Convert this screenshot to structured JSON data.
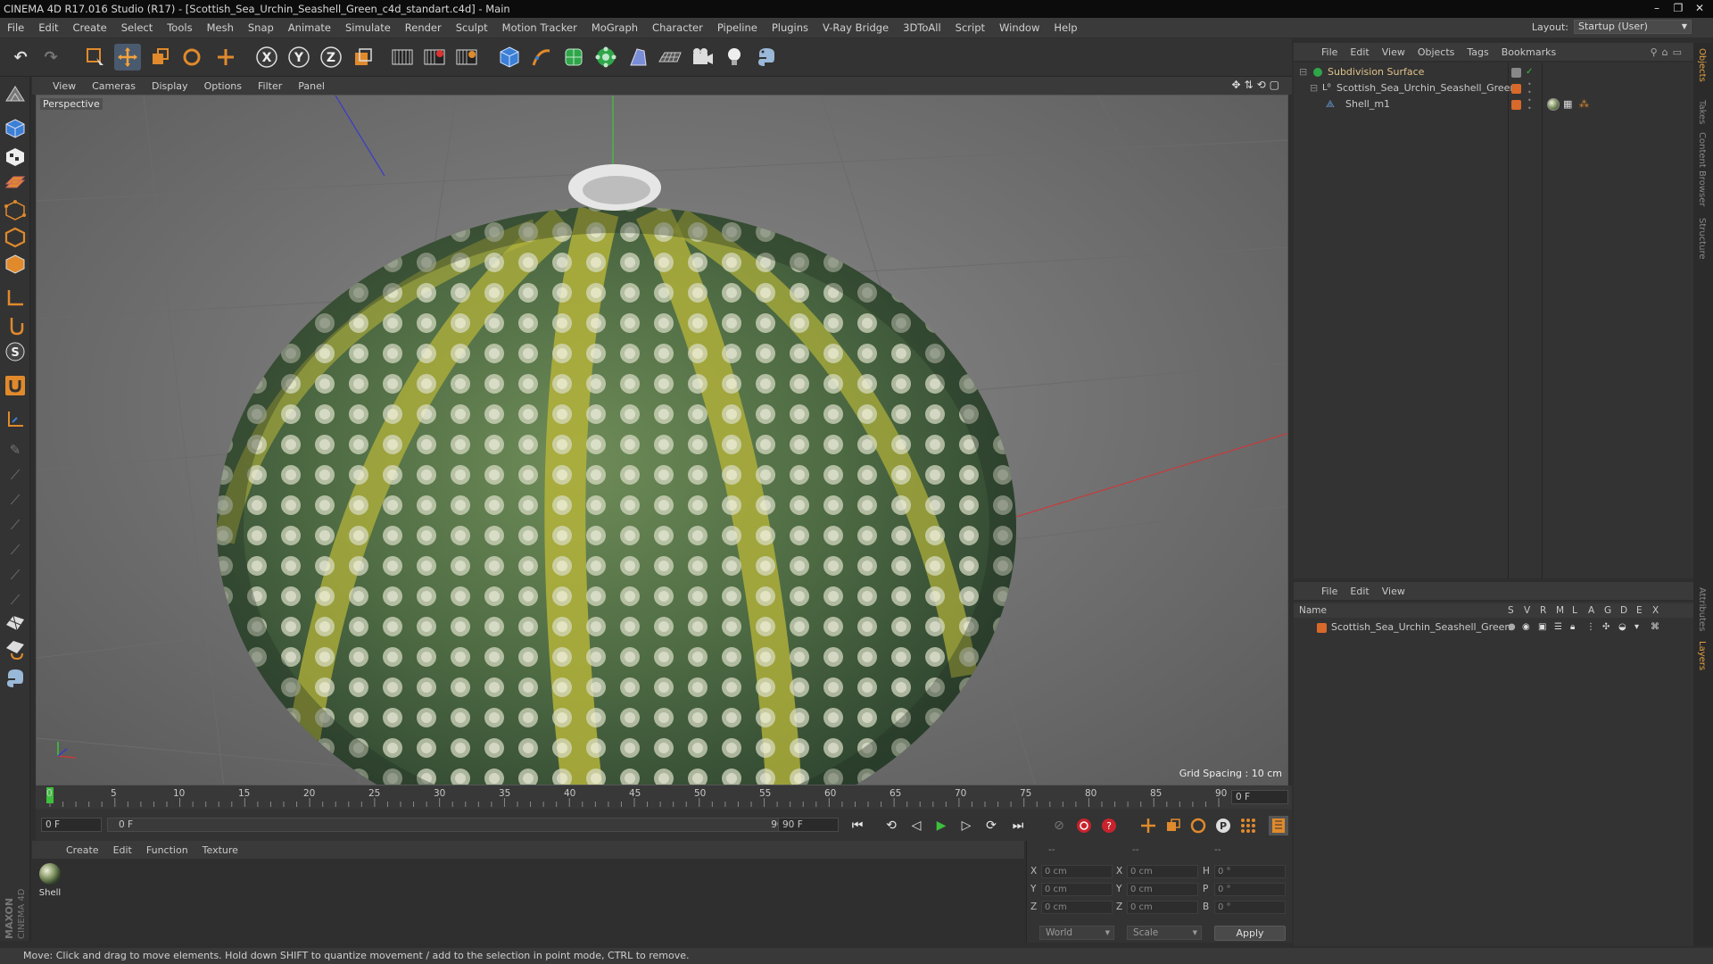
{
  "window": {
    "title": "CINEMA 4D R17.016 Studio (R17) - [Scottish_Sea_Urchin_Seashell_Green_c4d_standart.c4d] - Main"
  },
  "menubar": [
    "File",
    "Edit",
    "Create",
    "Select",
    "Tools",
    "Mesh",
    "Snap",
    "Animate",
    "Simulate",
    "Render",
    "Sculpt",
    "Motion Tracker",
    "MoGraph",
    "Character",
    "Pipeline",
    "Plugins",
    "V-Ray Bridge",
    "3DToAll",
    "Script",
    "Window",
    "Help"
  ],
  "layout": {
    "label": "Layout:",
    "value": "Startup (User)"
  },
  "viewport": {
    "menus": [
      "View",
      "Cameras",
      "Display",
      "Options",
      "Filter",
      "Panel"
    ],
    "label": "Perspective",
    "grid_spacing": "Grid Spacing : 10 cm"
  },
  "timeline": {
    "ticks": [
      "0",
      "5",
      "10",
      "15",
      "20",
      "25",
      "30",
      "35",
      "40",
      "45",
      "50",
      "55",
      "60",
      "65",
      "70",
      "75",
      "80",
      "85",
      "90"
    ],
    "current_frame_right": "0 F",
    "start_field": "0 F",
    "range_start": "0 F",
    "range_end": "90 F",
    "end_field": "90 F"
  },
  "material_manager": {
    "menus": [
      "Create",
      "Edit",
      "Function",
      "Texture"
    ],
    "materials": [
      {
        "name": "Shell"
      }
    ]
  },
  "coordinates": {
    "headers": [
      "--",
      "--",
      "--"
    ],
    "rows": [
      {
        "a": "X",
        "v1": "0 cm",
        "b": "X",
        "v2": "0 cm",
        "c": "H",
        "v3": "0 °"
      },
      {
        "a": "Y",
        "v1": "0 cm",
        "b": "Y",
        "v2": "0 cm",
        "c": "P",
        "v3": "0 °"
      },
      {
        "a": "Z",
        "v1": "0 cm",
        "b": "Z",
        "v2": "0 cm",
        "c": "B",
        "v3": "0 °"
      }
    ],
    "space": "World",
    "mode": "Scale",
    "apply": "Apply"
  },
  "object_manager": {
    "menus": [
      "File",
      "Edit",
      "View",
      "Objects",
      "Tags",
      "Bookmarks"
    ],
    "objects": [
      {
        "name": "Subdivision Surface"
      },
      {
        "name": "Scottish_Sea_Urchin_Seashell_Green"
      },
      {
        "name": "Shell_m1"
      }
    ]
  },
  "layer_manager": {
    "menus": [
      "File",
      "Edit",
      "View"
    ],
    "columns": {
      "name": "Name",
      "flags": [
        "S",
        "V",
        "R",
        "M",
        "L",
        "A",
        "G",
        "D",
        "E",
        "X"
      ]
    },
    "layers": [
      {
        "name": "Scottish_Sea_Urchin_Seashell_Green"
      }
    ]
  },
  "side_tabs": [
    "Objects",
    "Takes",
    "Content Browser",
    "Structure",
    "Attributes",
    "Layers"
  ],
  "status": "Move: Click and drag to move elements. Hold down SHIFT to quantize movement / add to the selection in point mode, CTRL to remove.",
  "branding": "MAXON CINEMA 4D",
  "colors": {
    "accent_orange": "#e08a2c",
    "accent_blue": "#3b7fd6",
    "layer_orange": "#d8692a",
    "active_green": "#3dbf3d"
  }
}
